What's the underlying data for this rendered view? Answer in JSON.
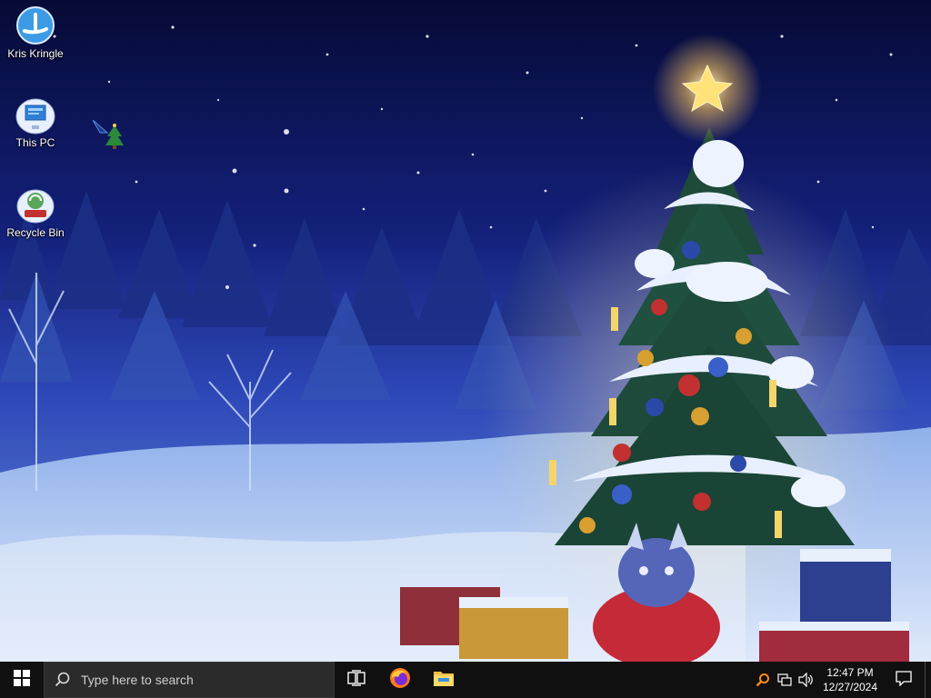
{
  "desktop": {
    "icons": [
      {
        "label": "Kris Kringle",
        "icon": "kris-kringle-app-icon"
      },
      {
        "label": "This PC",
        "icon": "computer-monitor-icon"
      },
      {
        "label": "Recycle Bin",
        "icon": "recycle-bin-icon"
      }
    ],
    "cursor_icon": "christmas-tree-cursor-icon"
  },
  "taskbar": {
    "start_icon": "windows-logo-icon",
    "search_placeholder": "Type here to search",
    "pinned": [
      {
        "name": "Task View",
        "icon": "task-view-icon"
      },
      {
        "name": "Firefox",
        "icon": "firefox-icon"
      },
      {
        "name": "File Explorer",
        "icon": "file-explorer-icon"
      }
    ],
    "tray_icons": [
      "search-magnifier-tray-icon",
      "network-icon",
      "volume-icon"
    ],
    "time": "12:47 PM",
    "date": "12/27/2024",
    "notification_icon": "action-center-icon"
  },
  "colors": {
    "taskbar_bg": "#101010",
    "search_bg": "#2b2b2b",
    "sky_top": "#0a1040",
    "snow": "#e6eef8"
  }
}
